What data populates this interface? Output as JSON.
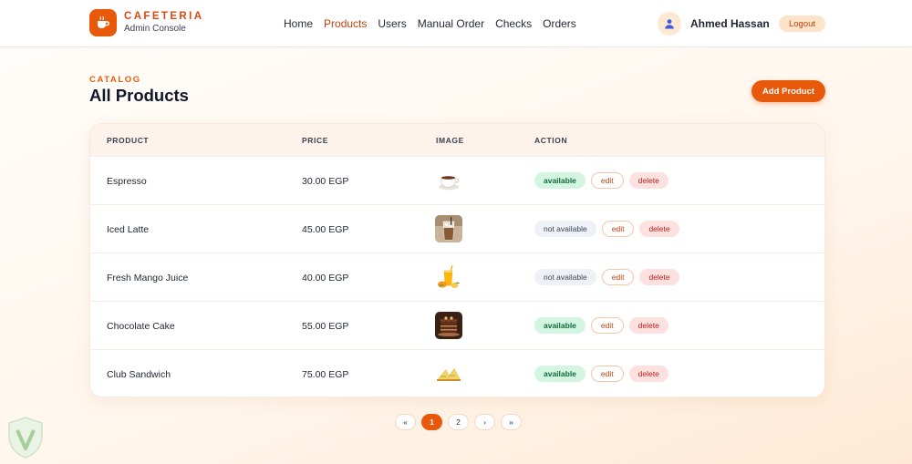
{
  "brand": {
    "name": "CAFETERIA",
    "subtitle": "Admin Console"
  },
  "nav": [
    {
      "label": "Home",
      "active": false
    },
    {
      "label": "Products",
      "active": true
    },
    {
      "label": "Users",
      "active": false
    },
    {
      "label": "Manual Order",
      "active": false
    },
    {
      "label": "Checks",
      "active": false
    },
    {
      "label": "Orders",
      "active": false
    }
  ],
  "user": {
    "name": "Ahmed Hassan",
    "logout_label": "Logout"
  },
  "page": {
    "eyebrow": "CATALOG",
    "title": "All Products",
    "add_label": "Add Product"
  },
  "table": {
    "headers": [
      "PRODUCT",
      "PRICE",
      "IMAGE",
      "ACTION"
    ],
    "rows": [
      {
        "name": "Espresso",
        "price": "30.00 EGP",
        "image_icon": "espresso-cup-icon",
        "status": "available",
        "available": true,
        "edit": "edit",
        "delete": "delete"
      },
      {
        "name": "Iced Latte",
        "price": "45.00 EGP",
        "image_icon": "iced-latte-icon",
        "status": "not available",
        "available": false,
        "edit": "edit",
        "delete": "delete"
      },
      {
        "name": "Fresh Mango Juice",
        "price": "40.00 EGP",
        "image_icon": "mango-juice-icon",
        "status": "not available",
        "available": false,
        "edit": "edit",
        "delete": "delete"
      },
      {
        "name": "Chocolate Cake",
        "price": "55.00 EGP",
        "image_icon": "chocolate-cake-icon",
        "status": "available",
        "available": true,
        "edit": "edit",
        "delete": "delete"
      },
      {
        "name": "Club Sandwich",
        "price": "75.00 EGP",
        "image_icon": "club-sandwich-icon",
        "status": "available",
        "available": true,
        "edit": "edit",
        "delete": "delete"
      }
    ]
  },
  "pagination": {
    "first": "«",
    "pages": [
      "1",
      "2"
    ],
    "current": "1",
    "next": "›",
    "last": "»"
  },
  "colors": {
    "accent": "#e8590c",
    "available_bg": "#d3f5e2",
    "delete_bg": "#fde0e0"
  }
}
